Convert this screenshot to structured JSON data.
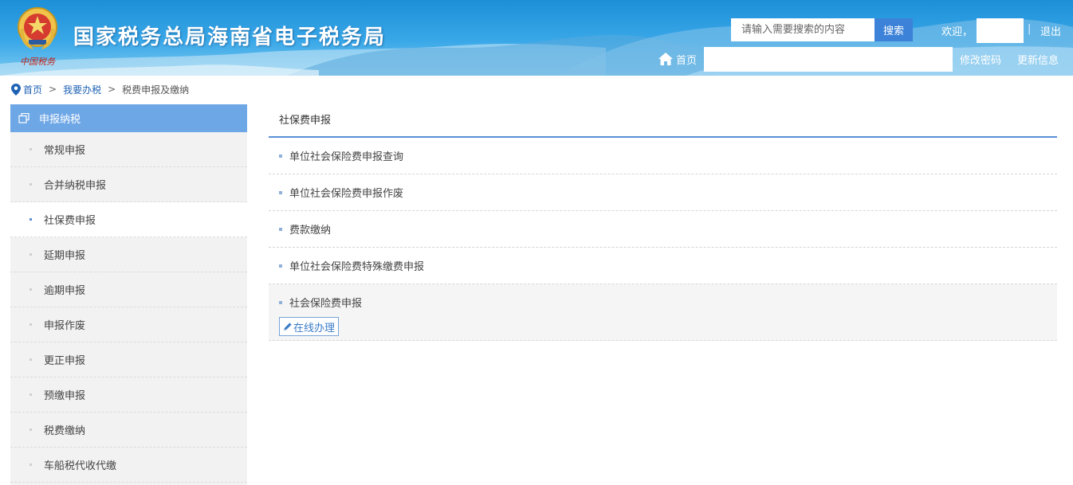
{
  "header": {
    "site_title": "国家税务总局海南省电子税务局",
    "emblem_text": "中国税务",
    "search_placeholder": "请输入需要搜索的内容",
    "search_button": "搜索",
    "welcome": "欢迎，",
    "separator": "|",
    "logout": "退出",
    "home": "首页",
    "change_password": "修改密码",
    "update_info": "更新信息",
    "icons": {
      "home": "home-icon",
      "emblem": "tax-emblem-logo"
    }
  },
  "breadcrumb": {
    "home": "首页",
    "arrow": ">",
    "level2": "我要办税",
    "current": "税费申报及缴纳",
    "icon": "location-pin-icon"
  },
  "sidebar": {
    "title": "申报纳税",
    "title_icon": "copy-windows-icon",
    "items": [
      {
        "label": "常规申报",
        "active": false
      },
      {
        "label": "合并纳税申报",
        "active": false
      },
      {
        "label": "社保费申报",
        "active": true
      },
      {
        "label": "延期申报",
        "active": false
      },
      {
        "label": "逾期申报",
        "active": false
      },
      {
        "label": "申报作废",
        "active": false
      },
      {
        "label": "更正申报",
        "active": false
      },
      {
        "label": "预缴申报",
        "active": false
      },
      {
        "label": "税费缴纳",
        "active": false
      },
      {
        "label": "车船税代收代缴",
        "active": false
      }
    ]
  },
  "main": {
    "title": "社保费申报",
    "items": [
      {
        "label": "单位社会保险费申报查询"
      },
      {
        "label": "单位社会保险费申报作废"
      },
      {
        "label": "费款缴纳"
      },
      {
        "label": "单位社会保险费特殊缴费申报"
      },
      {
        "label": "社会保险费申报",
        "button": "在线办理",
        "button_icon": "pencil-icon"
      }
    ]
  },
  "colors": {
    "header_blue": "#2f9ee3",
    "sidebar_header": "#6ea7e6",
    "search_button": "#3b82d8",
    "link_blue": "#1e62b5",
    "accent_line": "#5b8fd6"
  }
}
